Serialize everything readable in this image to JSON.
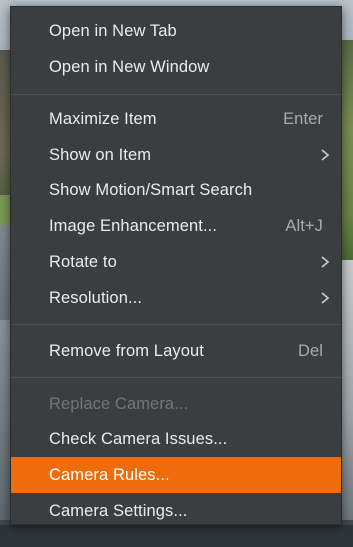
{
  "menu": {
    "items": [
      {
        "label": "Open in New Tab",
        "shortcut": "",
        "submenu": false,
        "disabled": false,
        "highlighted": false
      },
      {
        "label": "Open in New Window",
        "shortcut": "",
        "submenu": false,
        "disabled": false,
        "highlighted": false
      },
      {
        "label": "Maximize Item",
        "shortcut": "Enter",
        "submenu": false,
        "disabled": false,
        "highlighted": false
      },
      {
        "label": "Show on Item",
        "shortcut": "",
        "submenu": true,
        "disabled": false,
        "highlighted": false
      },
      {
        "label": "Show Motion/Smart Search",
        "shortcut": "",
        "submenu": false,
        "disabled": false,
        "highlighted": false
      },
      {
        "label": "Image Enhancement...",
        "shortcut": "Alt+J",
        "submenu": false,
        "disabled": false,
        "highlighted": false
      },
      {
        "label": "Rotate to",
        "shortcut": "",
        "submenu": true,
        "disabled": false,
        "highlighted": false
      },
      {
        "label": "Resolution...",
        "shortcut": "",
        "submenu": true,
        "disabled": false,
        "highlighted": false
      },
      {
        "label": "Remove from Layout",
        "shortcut": "Del",
        "submenu": false,
        "disabled": false,
        "highlighted": false
      },
      {
        "label": "Replace Camera...",
        "shortcut": "",
        "submenu": false,
        "disabled": true,
        "highlighted": false
      },
      {
        "label": "Check Camera Issues...",
        "shortcut": "",
        "submenu": false,
        "disabled": false,
        "highlighted": false
      },
      {
        "label": "Camera Rules...",
        "shortcut": "",
        "submenu": false,
        "disabled": false,
        "highlighted": true
      },
      {
        "label": "Camera Settings...",
        "shortcut": "",
        "submenu": false,
        "disabled": false,
        "highlighted": false
      }
    ],
    "icons": {
      "submenu_arrow": "chevron-right-icon"
    },
    "colors": {
      "background": "#3b3e40",
      "highlight": "#ef6c0c",
      "text": "#e9ecec",
      "disabled_text": "#70767a",
      "shortcut_text": "#a7abac"
    }
  }
}
